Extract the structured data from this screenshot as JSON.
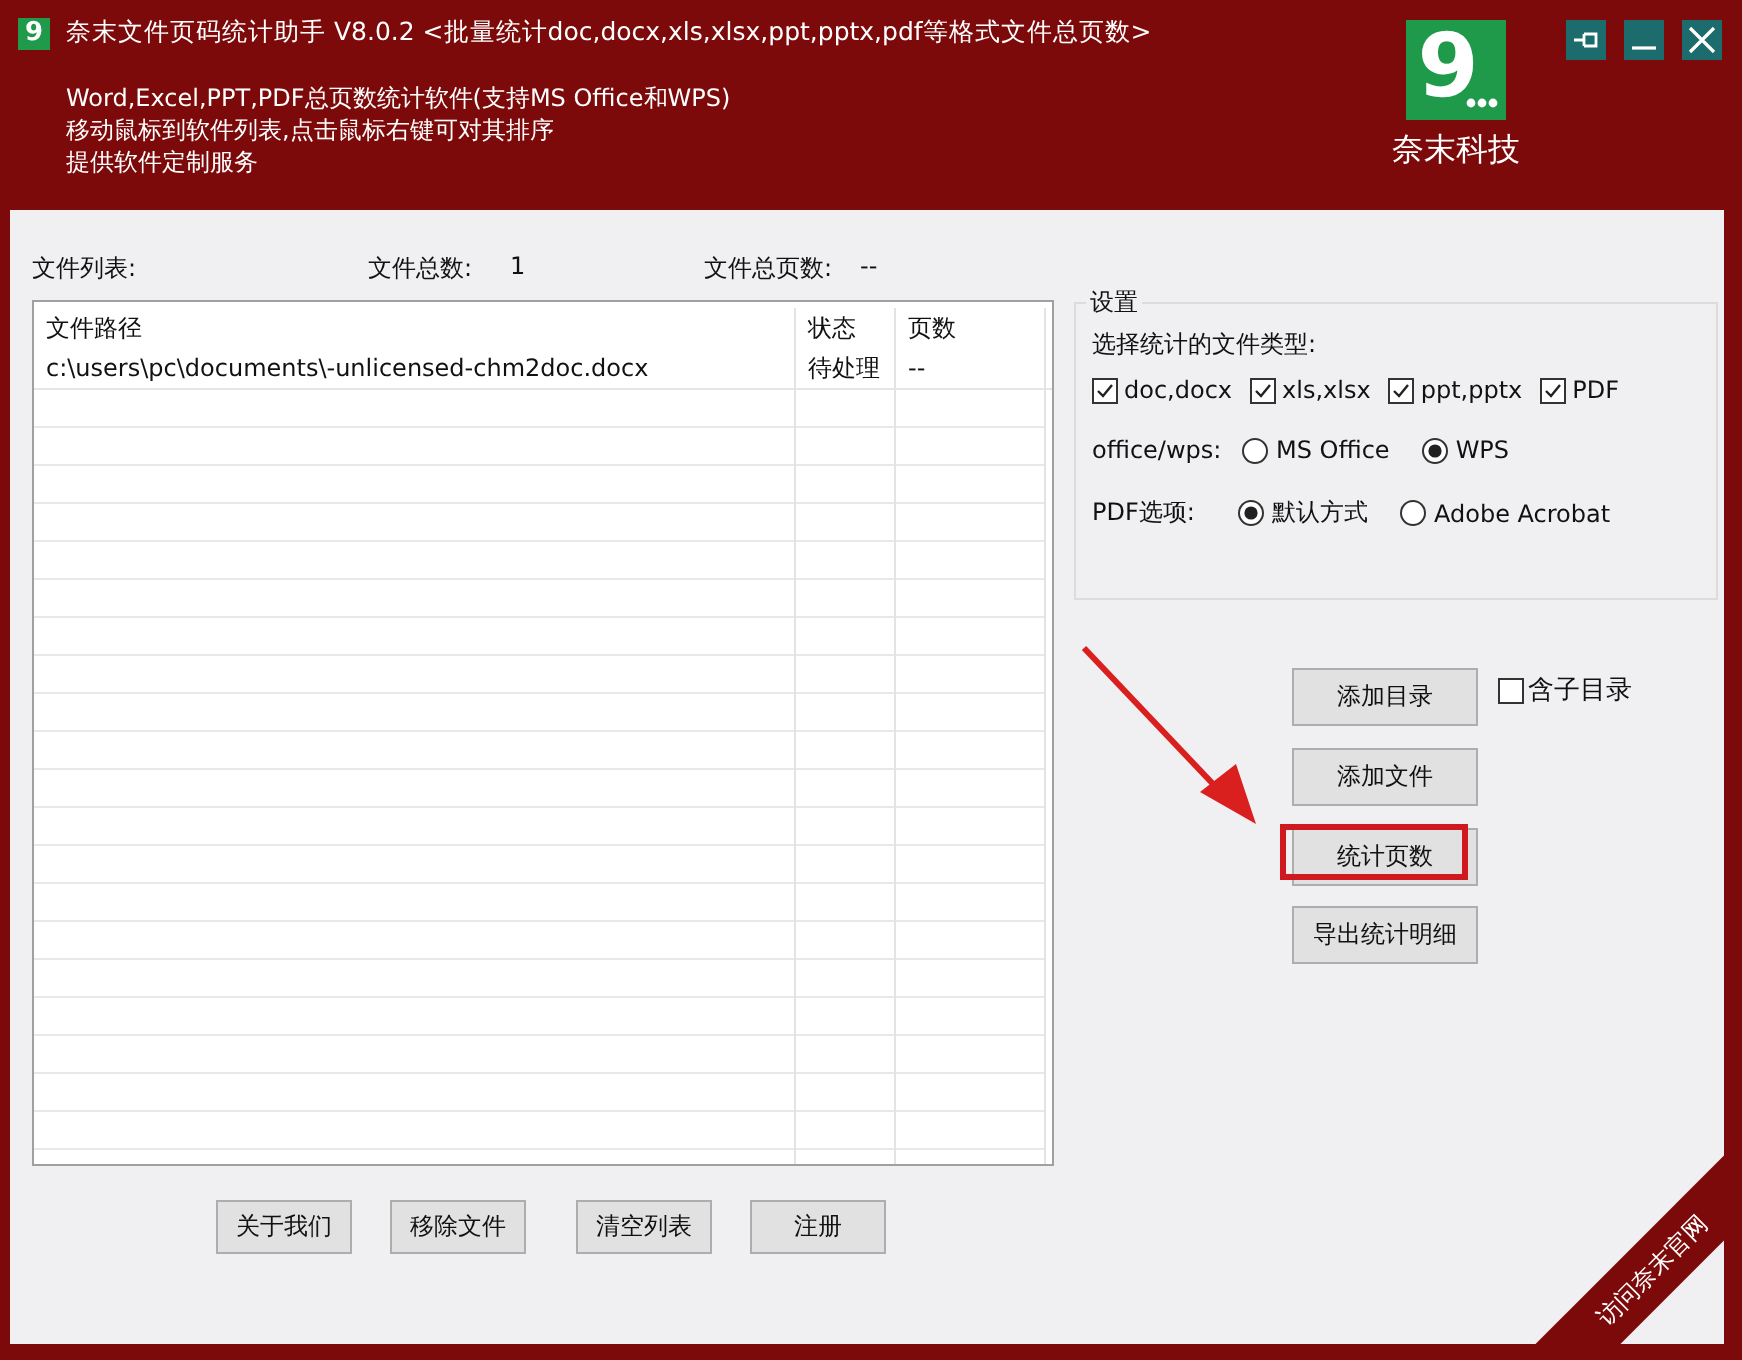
{
  "window": {
    "app_icon_mark": "9",
    "title": "奈末文件页码统计助手  V8.0.2  <批量统计doc,docx,xls,xlsx,ppt,pptx,pdf等格式文件总页数>"
  },
  "description": [
    "Word,Excel,PPT,PDF总页数统计软件(支持MS  Office和WPS)",
    "移动鼠标到软件列表,点击鼠标右键可对其排序",
    "提供软件定制服务"
  ],
  "logo": {
    "mark": "9",
    "name": "奈末科技"
  },
  "stats": {
    "list_label": "文件列表:",
    "count_label": "文件总数:",
    "count": "1",
    "pages_label": "文件总页数:",
    "pages": "--"
  },
  "table": {
    "columns": [
      "文件路径",
      "状态",
      "页数"
    ],
    "rows": [
      {
        "path": "c:\\users\\pc\\documents\\-unlicensed-chm2doc.docx",
        "status": "待处理",
        "pages": "--"
      }
    ]
  },
  "settings": {
    "title": "设置",
    "types_label": "选择统计的文件类型:",
    "types": [
      {
        "label": "doc,docx",
        "checked": true
      },
      {
        "label": "xls,xlsx",
        "checked": true
      },
      {
        "label": "ppt,pptx",
        "checked": true
      },
      {
        "label": "PDF",
        "checked": true
      }
    ],
    "engine_label": "office/wps:",
    "engines": [
      {
        "label": "MS Office",
        "selected": false
      },
      {
        "label": "WPS",
        "selected": true
      }
    ],
    "pdf_label": "PDF选项:",
    "pdf_options": [
      {
        "label": "默认方式",
        "selected": true
      },
      {
        "label": "Adobe Acrobat",
        "selected": false
      }
    ]
  },
  "actions": [
    {
      "label": "添加目录",
      "highlighted": false
    },
    {
      "label": "添加文件",
      "highlighted": false
    },
    {
      "label": "统计页数",
      "highlighted": true
    },
    {
      "label": "导出统计明细",
      "highlighted": false
    }
  ],
  "subfolder": {
    "label": "含子目录",
    "checked": false
  },
  "bottom_buttons": [
    "关于我们",
    "移除文件",
    "清空列表",
    "注册"
  ],
  "ribbon": "访问奈末官网"
}
